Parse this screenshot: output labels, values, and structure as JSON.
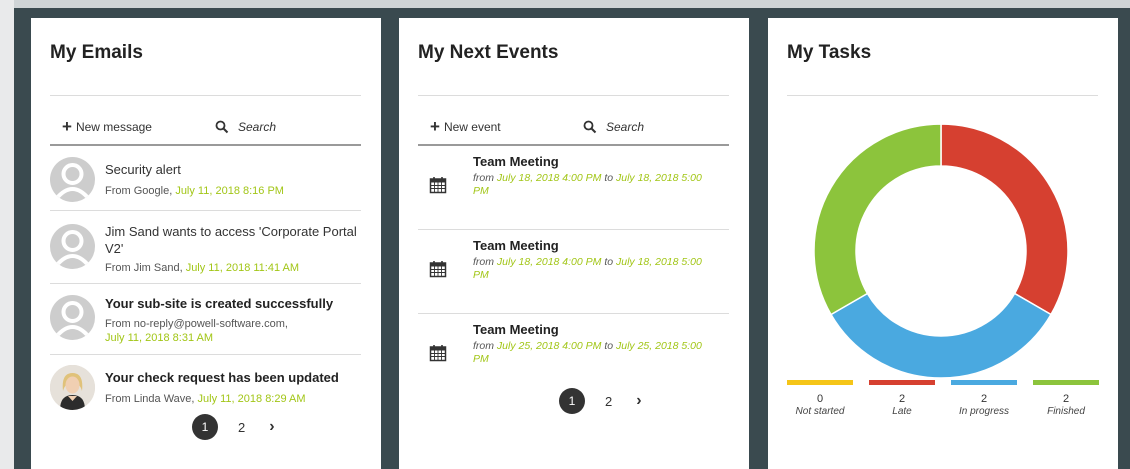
{
  "emails_card": {
    "title": "My Emails",
    "new_label": "New message",
    "search_placeholder": "Search",
    "items": [
      {
        "subject": "Security alert",
        "from_prefix": "From Google, ",
        "date": "July 11, 2018 8:16 PM",
        "bold": false,
        "avatar": "default"
      },
      {
        "subject": "Jim Sand wants to access 'Corporate Portal V2'",
        "from_prefix": "From Jim Sand, ",
        "date": "July 11, 2018 11:41 AM",
        "bold": false,
        "avatar": "default"
      },
      {
        "subject": "Your sub-site is created successfully",
        "from_prefix": "From no-reply@powell-software.com,",
        "date": "July 11, 2018 8:31 AM",
        "bold": true,
        "avatar": "default"
      },
      {
        "subject": "Your check request has been updated",
        "from_prefix": "From Linda Wave, ",
        "date": "July 11, 2018 8:29 AM",
        "bold": true,
        "avatar": "photo"
      }
    ],
    "pager": {
      "current": "1",
      "next_page": "2",
      "next_icon": "chevron-right-icon"
    }
  },
  "events_card": {
    "title": "My Next Events",
    "new_label": "New event",
    "search_placeholder": "Search",
    "items": [
      {
        "title": "Team Meeting",
        "from_word": "from ",
        "start": "July 18, 2018 4:00 PM",
        "to_word": " to ",
        "end": "July 18, 2018 5:00 PM"
      },
      {
        "title": "Team Meeting",
        "from_word": "from ",
        "start": "July 18, 2018 4:00 PM",
        "to_word": " to ",
        "end": "July 18, 2018 5:00 PM"
      },
      {
        "title": "Team Meeting",
        "from_word": "from ",
        "start": "July 25, 2018 4:00 PM",
        "to_word": " to ",
        "end": "July 25, 2018 5:00 PM"
      }
    ],
    "pager": {
      "current": "1",
      "next_page": "2",
      "next_icon": "chevron-right-icon"
    }
  },
  "tasks_card": {
    "title": "My Tasks",
    "chart_data": {
      "type": "pie",
      "categories": [
        "Not started",
        "Late",
        "In progress",
        "Finished"
      ],
      "values": [
        0,
        2,
        2,
        2
      ],
      "colors": [
        "#f5c518",
        "#d64030",
        "#4aa9e0",
        "#8cc43c"
      ]
    },
    "legend": [
      {
        "count": "0",
        "label": "Not started",
        "color": "#f5c518"
      },
      {
        "count": "2",
        "label": "Late",
        "color": "#d64030"
      },
      {
        "count": "2",
        "label": "In progress",
        "color": "#4aa9e0"
      },
      {
        "count": "2",
        "label": "Finished",
        "color": "#8cc43c"
      }
    ]
  },
  "colors": {
    "accent_green": "#a2c617",
    "frame": "#3a4a4f"
  }
}
